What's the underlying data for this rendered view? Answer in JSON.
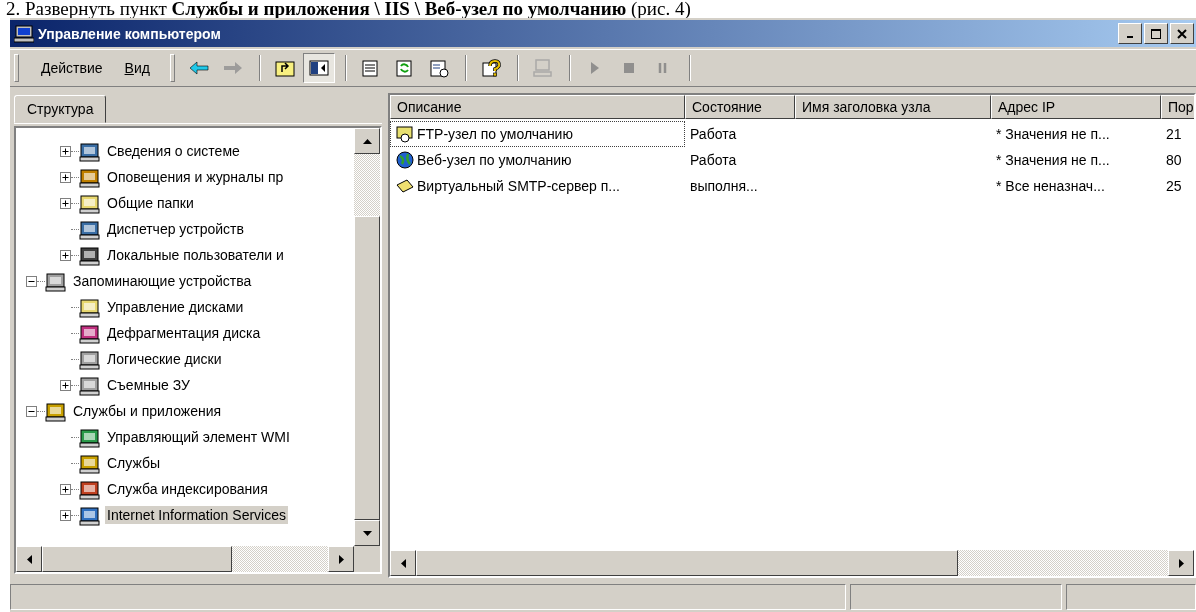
{
  "caption": "2. Развернуть пункт **Службы и приложения \\ IIS \\ Веб-узел по умолчанию** (рис. 4)",
  "window": {
    "title": "Управление компьютером"
  },
  "menu": [
    {
      "label": "Действие"
    },
    {
      "label": "Вид"
    }
  ],
  "toolbar": {
    "groups": [
      {
        "buttons": [
          {
            "disabled": false,
            "pressed": false
          },
          {
            "disabled": true,
            "pressed": false
          }
        ]
      },
      {
        "buttons": [
          {
            "disabled": false,
            "pressed": false
          },
          {
            "disabled": false,
            "pressed": true
          }
        ]
      },
      {
        "buttons": [
          {
            "disabled": false,
            "pressed": false
          },
          {
            "disabled": false,
            "pressed": false
          },
          {
            "disabled": false,
            "pressed": false
          }
        ]
      },
      {
        "buttons": [
          {
            "disabled": false,
            "pressed": false
          }
        ]
      },
      {
        "buttons": [
          {
            "disabled": true,
            "pressed": false
          }
        ]
      },
      {
        "buttons": [
          {
            "disabled": true,
            "pressed": false
          },
          {
            "disabled": true,
            "pressed": false
          },
          {
            "disabled": true,
            "pressed": false
          }
        ]
      }
    ]
  },
  "tabs": [
    {
      "label": "Структура",
      "selected": true
    }
  ],
  "tree": {
    "cut_branch": [
      {
        "label": "Сведения о системе",
        "has_children": true,
        "expanded": false,
        "selected": false
      },
      {
        "label": "Оповещения и журналы пр",
        "has_children": true,
        "expanded": false,
        "selected": false
      },
      {
        "label": "Общие папки",
        "has_children": true,
        "expanded": false,
        "selected": false
      },
      {
        "label": "Диспетчер устройств",
        "has_children": false,
        "selected": false
      },
      {
        "label": "Локальные пользователи и",
        "has_children": true,
        "expanded": false,
        "selected": false
      }
    ],
    "nodes": [
      {
        "label": "Запоминающие устройства",
        "has_children": true,
        "expanded": true,
        "selected": false,
        "children": [
          {
            "label": "Управление дисками",
            "has_children": false,
            "selected": false
          },
          {
            "label": "Дефрагментация диска",
            "has_children": false,
            "selected": false
          },
          {
            "label": "Логические диски",
            "has_children": false,
            "selected": false
          },
          {
            "label": "Съемные ЗУ",
            "has_children": true,
            "expanded": false,
            "selected": false
          }
        ]
      },
      {
        "label": "Службы и приложения",
        "has_children": true,
        "expanded": true,
        "selected": false,
        "children": [
          {
            "label": "Управляющий элемент WMI",
            "has_children": false,
            "selected": false
          },
          {
            "label": "Службы",
            "has_children": false,
            "selected": false
          },
          {
            "label": "Служба индексирования",
            "has_children": true,
            "expanded": false,
            "selected": false
          },
          {
            "label": "Internet Information Services",
            "has_children": true,
            "expanded": false,
            "selected": true
          }
        ]
      }
    ]
  },
  "table": {
    "columns": [
      "Описание",
      "Состояние",
      "Имя заголовка узла",
      "Адрес IP",
      "Пор"
    ],
    "rows": [
      {
        "description": "FTP-узел по умолчанию",
        "status": "Работа",
        "ip": "* Значения не п...",
        "port": "21",
        "focused": true
      },
      {
        "description": "Веб-узел по умолчанию",
        "status": "Работа",
        "ip": "* Значения не п...",
        "port": "80",
        "focused": false
      },
      {
        "description": "Виртуальный SMTP-сервер п...",
        "status": "выполня...",
        "ip": "* Все неназнач...",
        "port": "25",
        "focused": false
      }
    ]
  }
}
